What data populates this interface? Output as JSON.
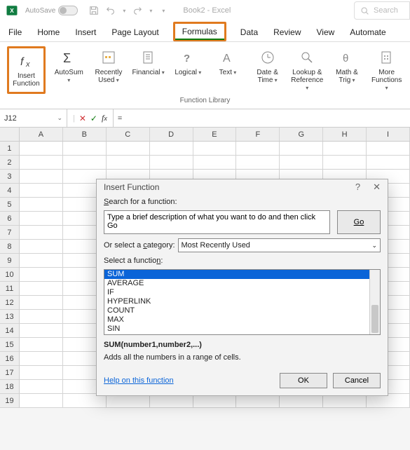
{
  "titlebar": {
    "autosave_label": "AutoSave",
    "autosave_state": "Off",
    "doc_title": "Book2 - Excel",
    "search_placeholder": "Search"
  },
  "tabs": [
    "File",
    "Home",
    "Insert",
    "Page Layout",
    "Formulas",
    "Data",
    "Review",
    "View",
    "Automate"
  ],
  "active_tab_index": 4,
  "ribbon": {
    "group_label": "Function Library",
    "buttons": [
      {
        "label": "Insert\nFunction",
        "icon": "fx-icon",
        "dropdown": false,
        "highlight": true
      },
      {
        "label": "AutoSum",
        "icon": "sigma-icon",
        "dropdown": true
      },
      {
        "label": "Recently\nUsed",
        "icon": "recent-icon",
        "dropdown": true
      },
      {
        "label": "Financial",
        "icon": "financial-icon",
        "dropdown": true
      },
      {
        "label": "Logical",
        "icon": "logical-icon",
        "dropdown": true
      },
      {
        "label": "Text",
        "icon": "text-icon",
        "dropdown": true
      },
      {
        "label": "Date &\nTime",
        "icon": "date-icon",
        "dropdown": true
      },
      {
        "label": "Lookup &\nReference",
        "icon": "lookup-icon",
        "dropdown": true
      },
      {
        "label": "Math &\nTrig",
        "icon": "math-icon",
        "dropdown": true
      },
      {
        "label": "More\nFunctions",
        "icon": "more-icon",
        "dropdown": true
      }
    ]
  },
  "namebox": {
    "value": "J12"
  },
  "formula_bar": {
    "value": "="
  },
  "columns": [
    "A",
    "B",
    "C",
    "D",
    "E",
    "F",
    "G",
    "H",
    "I"
  ],
  "row_count": 19,
  "dialog": {
    "title": "Insert Function",
    "search_label": "Search for a function:",
    "search_value": "Type a brief description of what you want to do and then click Go",
    "go_label": "Go",
    "category_label": "Or select a category:",
    "category_value": "Most Recently Used",
    "select_label": "Select a function:",
    "functions": [
      "SUM",
      "AVERAGE",
      "IF",
      "HYPERLINK",
      "COUNT",
      "MAX",
      "SIN"
    ],
    "selected_index": 0,
    "syntax": "SUM(number1,number2,...)",
    "description": "Adds all the numbers in a range of cells.",
    "help_label": "Help on this function",
    "ok_label": "OK",
    "cancel_label": "Cancel"
  }
}
